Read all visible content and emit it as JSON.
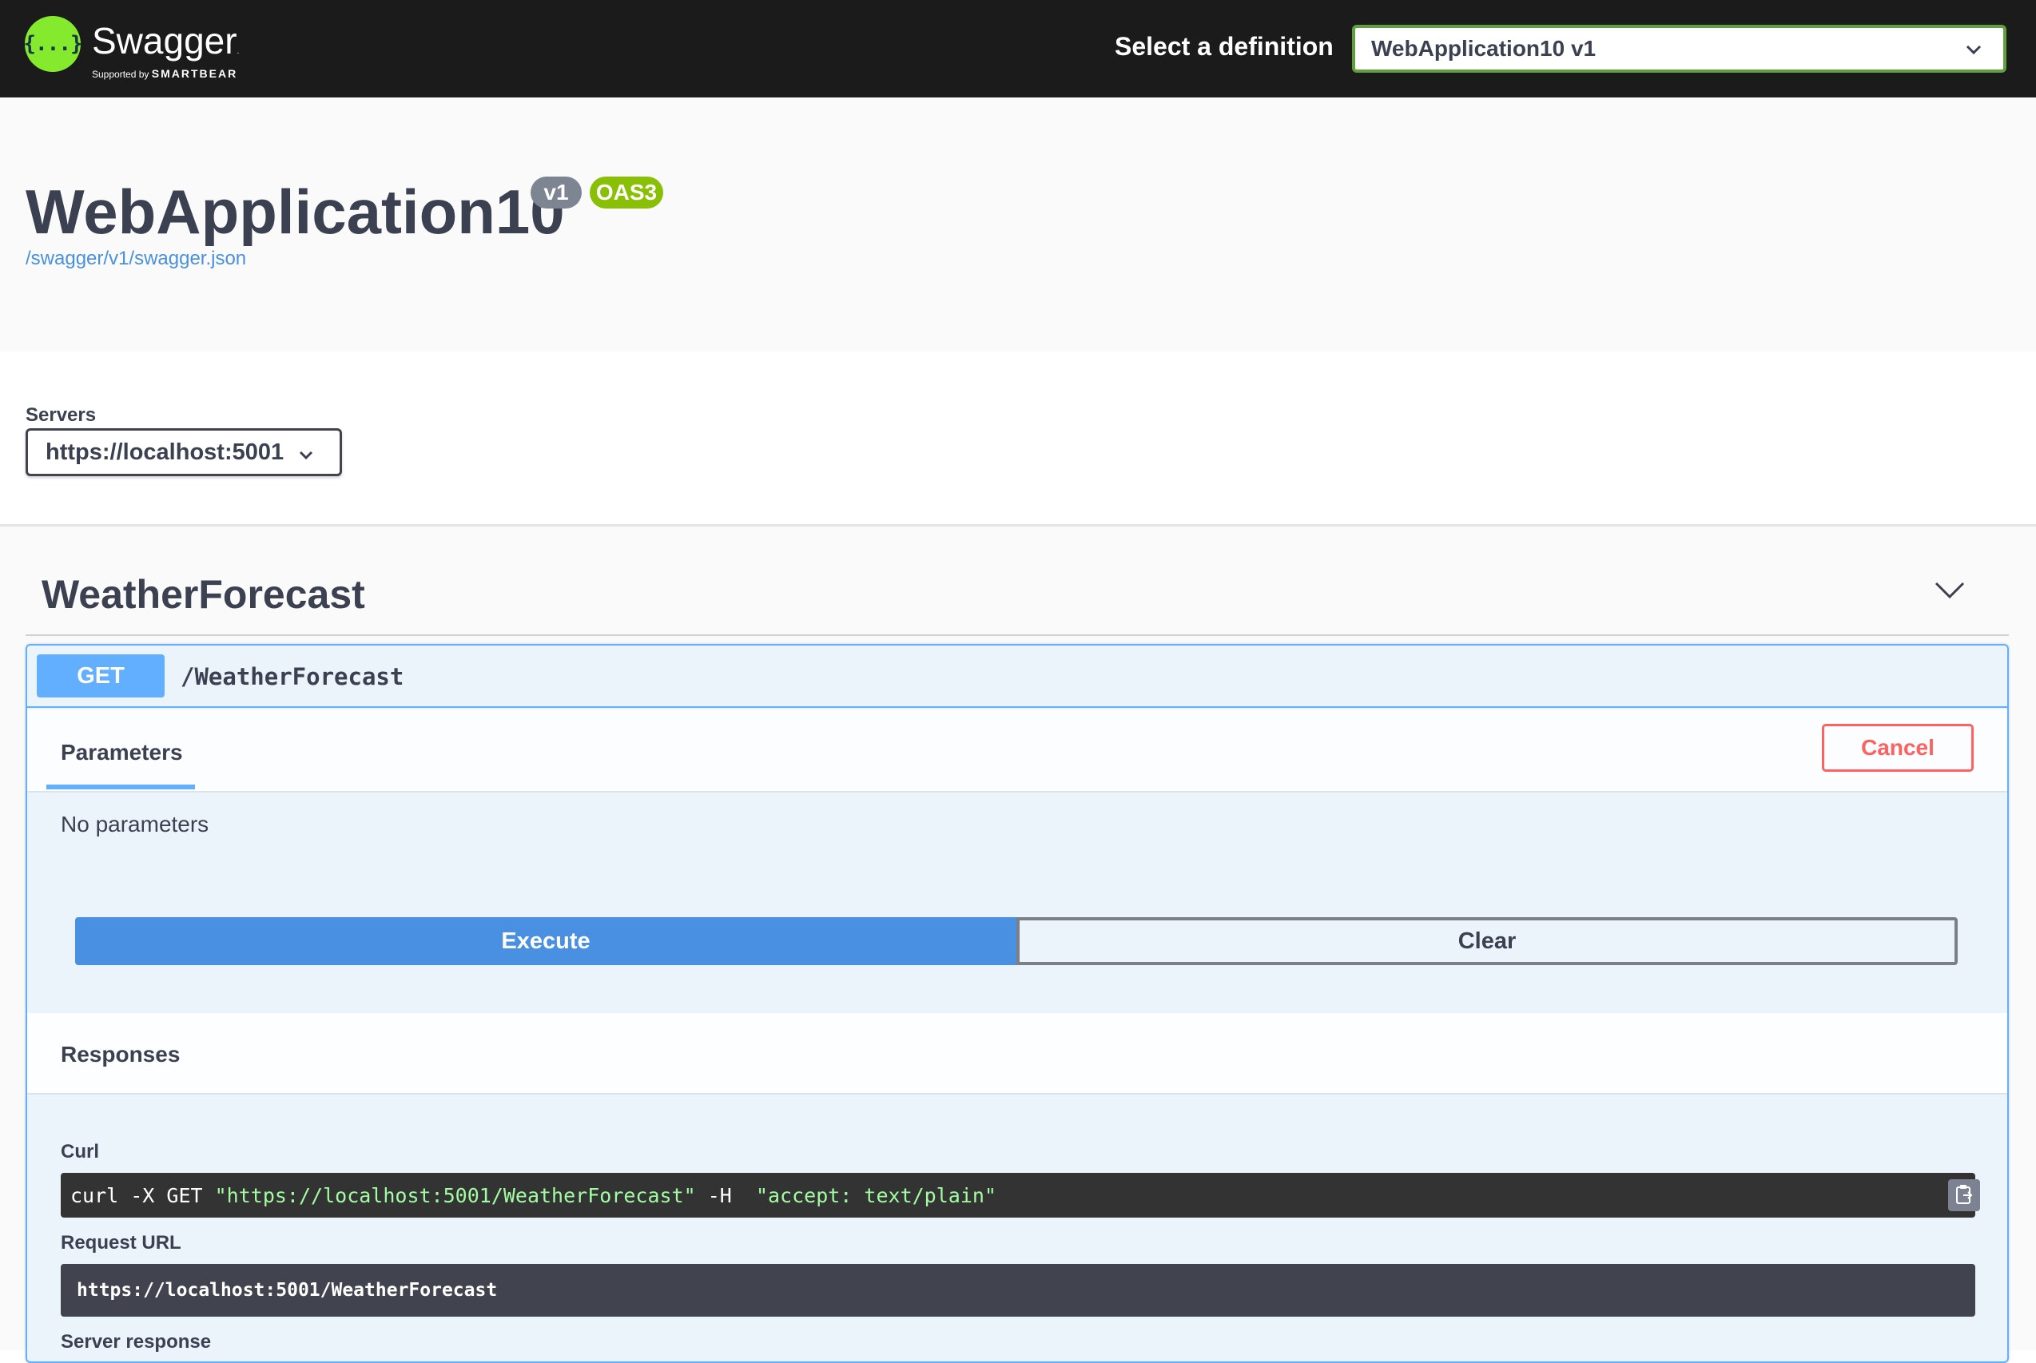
{
  "topbar": {
    "logo_glyph": "{...}",
    "logo_title": "Swagger",
    "logo_tm": ".",
    "logo_sub_prefix": "Supported by",
    "logo_sub_brand": "SMARTBEAR",
    "definition_label": "Select a definition",
    "definition_value": "WebApplication10 v1",
    "chevron_icon": "chevron-down-icon"
  },
  "info": {
    "title": "WebApplication10",
    "version_badge": "v1",
    "oas_badge": "OAS3",
    "spec_link": "/swagger/v1/swagger.json"
  },
  "servers": {
    "label": "Servers",
    "selected": "https://localhost:5001"
  },
  "tag": {
    "name": "WeatherForecast",
    "toggle_icon": "chevron-down-icon"
  },
  "operation": {
    "method": "GET",
    "path": "/WeatherForecast",
    "parameters_tab": "Parameters",
    "cancel_label": "Cancel",
    "no_params": "No parameters",
    "execute_label": "Execute",
    "clear_label": "Clear",
    "responses_title": "Responses",
    "curl_label": "Curl",
    "curl_cmd": "curl -X GET ",
    "curl_url": "\"https://localhost:5001/WeatherForecast\"",
    "curl_flag": " -H  ",
    "curl_header": "\"accept: text/plain\"",
    "copy_icon": "clipboard-icon",
    "request_url_label": "Request URL",
    "request_url": "https://localhost:5001/WeatherForecast",
    "server_response_label": "Server response"
  },
  "colors": {
    "topbar_bg": "#1b1b1b",
    "get_blue": "#61affe",
    "execute_blue": "#4990e2",
    "cancel_red": "#ff6060",
    "oas_green": "#89bf04",
    "logo_green": "#85ea2d"
  }
}
